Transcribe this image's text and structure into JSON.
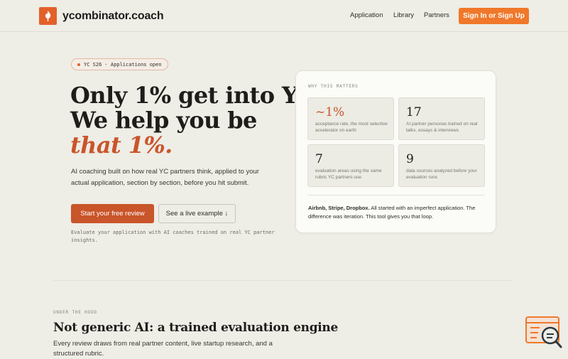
{
  "header": {
    "brand": "ycombinator.coach",
    "nav": [
      "Application",
      "Library",
      "Partners"
    ],
    "cta": "Sign In or Sign Up"
  },
  "hero": {
    "badge": "YC S26 · Applications open",
    "title_line1": "Only 1% get into YC.",
    "title_line2": "We help you be",
    "title_accent": "that 1%.",
    "subtitle": "AI coaching built on how real YC partners think, applied to your actual application, section by section, before you hit submit.",
    "primary_button": "Start your free review",
    "secondary_button": "See a live example ↓",
    "note": "Evaluate your application with AI coaches trained on real YC partner insights."
  },
  "card": {
    "eyebrow": "WHY THIS MATTERS",
    "stats": [
      {
        "value": "~1%",
        "desc": "acceptance rate, the most selective accelerator on earth"
      },
      {
        "value": "17",
        "desc": "AI partner personas trained on real talks, essays & interviews"
      },
      {
        "value": "7",
        "desc": "evaluation areas using the same rubric YC partners use"
      },
      {
        "value": "9",
        "desc": "data sources analyzed before your evaluation runs"
      }
    ],
    "footer_bold": "Airbnb, Stripe, Dropbox.",
    "footer_text": " All started with an imperfect application. The difference was iteration. This tool gives you that loop."
  },
  "section": {
    "eyebrow": "UNDER THE HOOD",
    "title": "Not generic AI: a trained evaluation engine",
    "subtitle": "Every review draws from real partner content, live startup research, and a structured rubric."
  },
  "colors": {
    "accent": "#e2602a",
    "accent_dark": "#c9552a",
    "background": "#eeede6"
  },
  "icons": {
    "logo": "flame-logo-icon",
    "widget": "chat-search-widget-icon"
  }
}
